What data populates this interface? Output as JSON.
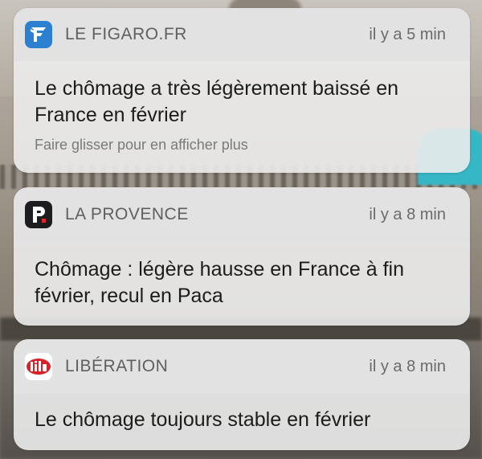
{
  "notifications": [
    {
      "app": "LE FIGARO.FR",
      "icon": "figaro-f-icon",
      "time": "il y a 5 min",
      "message": "Le chômage a très légèrement baissé en France en février",
      "hint": "Faire glisser pour en afficher plus"
    },
    {
      "app": "LA PROVENCE",
      "icon": "provence-p-icon",
      "time": "il y a 8 min",
      "message": "Chômage : légère hausse en France à fin février, recul en Paca"
    },
    {
      "app": "LIBÉRATION",
      "icon": "liberation-libe-icon",
      "time": "il y a 8 min",
      "message": "Le chômage toujours stable en février"
    }
  ],
  "colors": {
    "figaro": "#2d7fd0",
    "provence": "#1d1d1f",
    "liberation": "#d8202a"
  }
}
